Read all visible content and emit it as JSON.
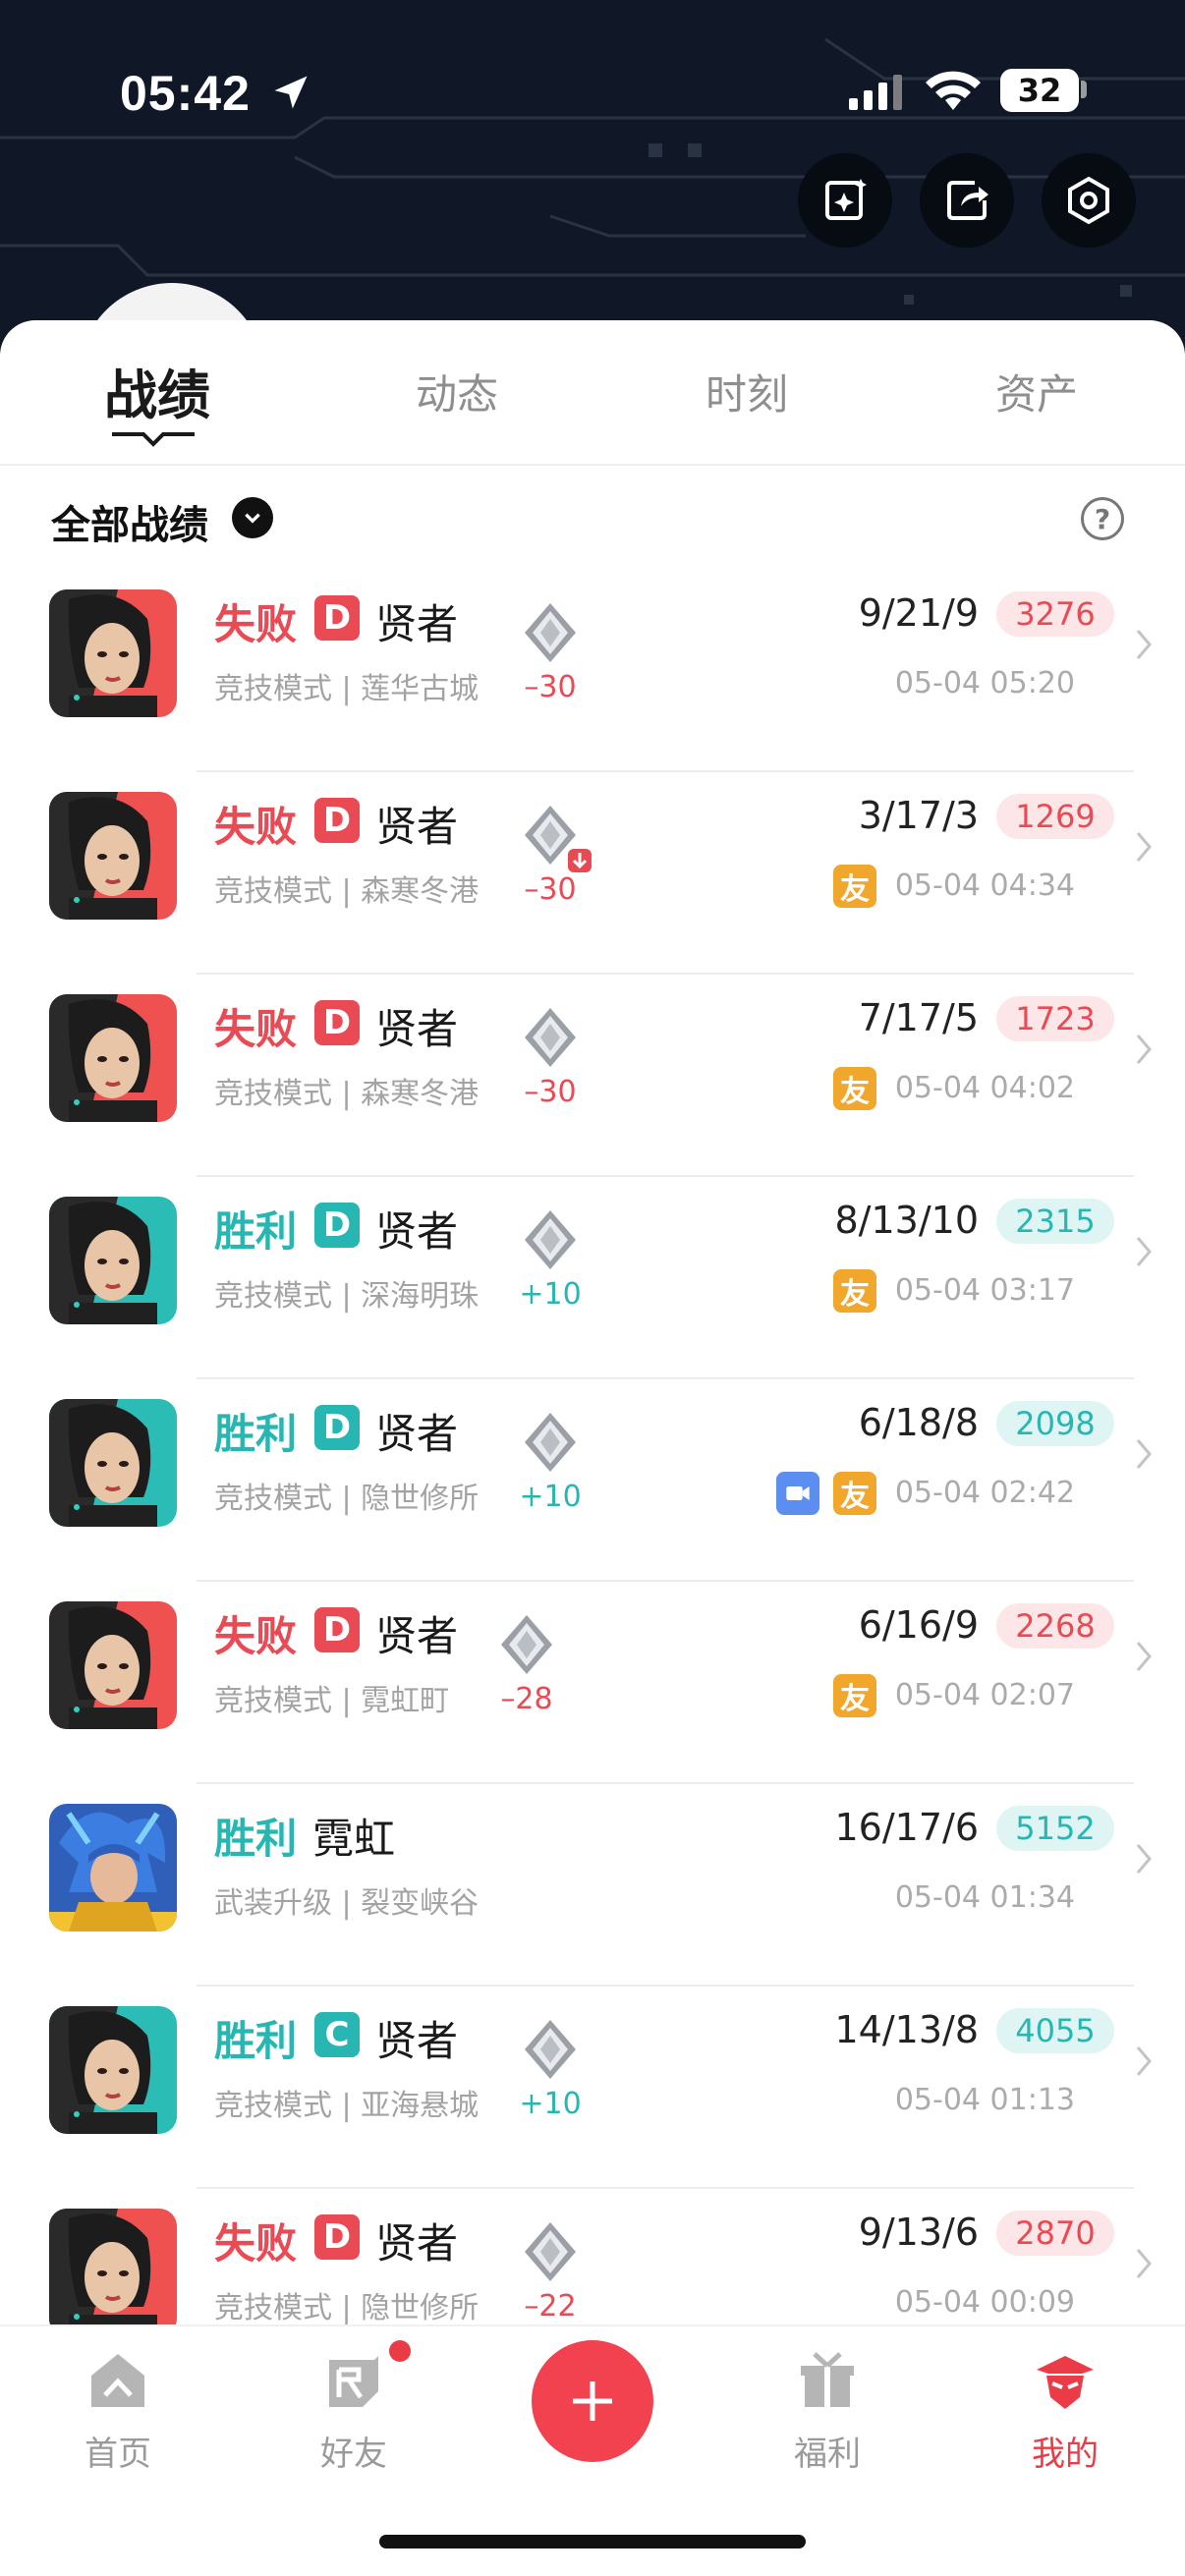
{
  "status_bar": {
    "time": "05:42",
    "battery": "32"
  },
  "header_actions": [
    {
      "name": "ai-edit-icon"
    },
    {
      "name": "share-icon"
    },
    {
      "name": "settings-icon"
    }
  ],
  "tabs": [
    {
      "label": "战绩",
      "active": true
    },
    {
      "label": "动态",
      "active": false
    },
    {
      "label": "时刻",
      "active": false
    },
    {
      "label": "资产",
      "active": false
    }
  ],
  "filter": {
    "label": "全部战绩",
    "help": "?"
  },
  "matches": [
    {
      "result": "失败",
      "outcome": "lose",
      "grade": "D",
      "agent": "贤者",
      "mode": "竞技模式 | 莲华古城",
      "rank_delta": "–30",
      "rank_down": false,
      "kda": "9/21/9",
      "score": "3276",
      "datetime": "05-04 05:20",
      "friend": false,
      "video": false,
      "avatar": "sage",
      "avatar_bg": "#ef5050"
    },
    {
      "result": "失败",
      "outcome": "lose",
      "grade": "D",
      "agent": "贤者",
      "mode": "竞技模式 | 森寒冬港",
      "rank_delta": "–30",
      "rank_down": true,
      "kda": "3/17/3",
      "score": "1269",
      "datetime": "05-04 04:34",
      "friend": true,
      "video": false,
      "avatar": "sage",
      "avatar_bg": "#ef5050"
    },
    {
      "result": "失败",
      "outcome": "lose",
      "grade": "D",
      "agent": "贤者",
      "mode": "竞技模式 | 森寒冬港",
      "rank_delta": "–30",
      "rank_down": false,
      "kda": "7/17/5",
      "score": "1723",
      "datetime": "05-04 04:02",
      "friend": true,
      "video": false,
      "avatar": "sage",
      "avatar_bg": "#ef5050"
    },
    {
      "result": "胜利",
      "outcome": "win",
      "grade": "D",
      "agent": "贤者",
      "mode": "竞技模式 | 深海明珠",
      "rank_delta": "+10",
      "rank_down": false,
      "kda": "8/13/10",
      "score": "2315",
      "datetime": "05-04 03:17",
      "friend": true,
      "video": false,
      "avatar": "sage",
      "avatar_bg": "#2bbcb6"
    },
    {
      "result": "胜利",
      "outcome": "win",
      "grade": "D",
      "agent": "贤者",
      "mode": "竞技模式 | 隐世修所",
      "rank_delta": "+10",
      "rank_down": false,
      "kda": "6/18/8",
      "score": "2098",
      "datetime": "05-04 02:42",
      "friend": true,
      "video": true,
      "avatar": "sage",
      "avatar_bg": "#2bbcb6"
    },
    {
      "result": "失败",
      "outcome": "lose",
      "grade": "D",
      "agent": "贤者",
      "mode": "竞技模式 | 霓虹町",
      "rank_delta": "–28",
      "rank_down": false,
      "kda": "6/16/9",
      "score": "2268",
      "datetime": "05-04 02:07",
      "friend": true,
      "video": false,
      "avatar": "sage",
      "avatar_bg": "#ef5050"
    },
    {
      "result": "胜利",
      "outcome": "win",
      "grade": "",
      "agent": "霓虹",
      "mode": "武装升级 | 裂变峡谷",
      "rank_delta": "",
      "rank_down": false,
      "kda": "16/17/6",
      "score": "5152",
      "datetime": "05-04 01:34",
      "friend": false,
      "video": false,
      "avatar": "neon",
      "avatar_bg": "#2f5fb8"
    },
    {
      "result": "胜利",
      "outcome": "win",
      "grade": "C",
      "agent": "贤者",
      "mode": "竞技模式 | 亚海悬城",
      "rank_delta": "+10",
      "rank_down": false,
      "kda": "14/13/8",
      "score": "4055",
      "datetime": "05-04 01:13",
      "friend": false,
      "video": false,
      "avatar": "sage",
      "avatar_bg": "#2bbcb6"
    },
    {
      "result": "失败",
      "outcome": "lose",
      "grade": "D",
      "agent": "贤者",
      "mode": "竞技模式 | 隐世修所",
      "rank_delta": "–22",
      "rank_down": false,
      "kda": "9/13/6",
      "score": "2870",
      "datetime": "05-04 00:09",
      "friend": false,
      "video": false,
      "avatar": "sage",
      "avatar_bg": "#ef5050"
    }
  ],
  "friend_badge": "友",
  "nav": [
    {
      "label": "首页",
      "icon": "home-icon",
      "active": false
    },
    {
      "label": "好友",
      "icon": "friends-icon",
      "active": false,
      "badge": true
    },
    {
      "label": "",
      "icon": "plus-icon",
      "active": false
    },
    {
      "label": "福利",
      "icon": "gift-icon",
      "active": false
    },
    {
      "label": "我的",
      "icon": "profile-icon",
      "active": true
    }
  ],
  "colors": {
    "lose": "#ea4a53",
    "win": "#28b6b2",
    "accent": "#f2414f",
    "header_bg": "#101827"
  }
}
